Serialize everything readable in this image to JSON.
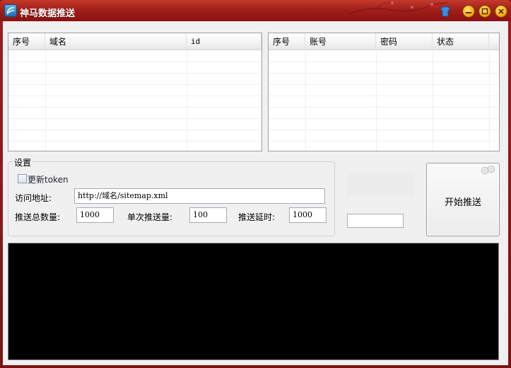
{
  "window": {
    "title": "神马数据推送"
  },
  "domain_list": {
    "columns": [
      "序号",
      "域名",
      "id"
    ]
  },
  "account_list": {
    "columns": [
      "序号",
      "账号",
      "密码",
      "状态"
    ]
  },
  "settings": {
    "legend": "设置",
    "update_token_label": "更新token",
    "update_token_checked": false,
    "url_label": "访问地址:",
    "url_value": "http://域名/sitemap.xml",
    "total_label": "推送总数量:",
    "total_value": "1000",
    "per_push_label": "单次推送量:",
    "per_push_value": "100",
    "delay_label": "推送延时:",
    "delay_value": "1000"
  },
  "progress": {
    "value": ""
  },
  "start_button": {
    "label": "开始推送"
  },
  "colors": {
    "title_bar": "#a31f1a",
    "console_bg": "#000000"
  }
}
